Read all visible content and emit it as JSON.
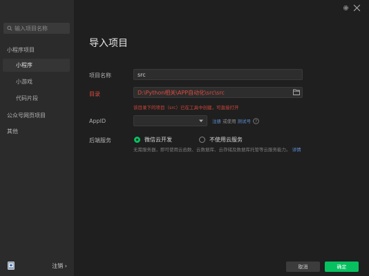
{
  "sidebar": {
    "search_placeholder": "输入项目名称",
    "group_miniprogram": "小程序项目",
    "items": [
      {
        "label": "小程序"
      },
      {
        "label": "小游戏"
      },
      {
        "label": "代码片段"
      }
    ],
    "group_official": "公众号网页项目",
    "group_other": "其他",
    "logout_label": "注销 ›"
  },
  "main": {
    "title": "导入项目",
    "project_name_label": "项目名称",
    "project_name_value": "src",
    "directory_label": "目录",
    "directory_value": "D:\\Python相关\\APP自动化\\src\\src",
    "directory_error": "该目录下的项目（src）已在工具中创建，可直接打开",
    "appid_label": "AppID",
    "appid_value": "",
    "appid_register": "注册",
    "appid_or": " 或使用 ",
    "appid_test": "测试号",
    "backend_label": "后端服务",
    "backend_options": [
      {
        "label": "微信云开发",
        "selected": true
      },
      {
        "label": "不使用云服务",
        "selected": false
      }
    ],
    "backend_desc": "无需服务器，即可使用云函数、云数据库、云存储及数据库托管等云服务能力。",
    "backend_desc_link": "详情"
  },
  "footer": {
    "cancel_label": "取消",
    "confirm_label": "确定"
  },
  "colors": {
    "accent": "#07c160",
    "error": "#e04b3e",
    "link": "#5f8fd4"
  }
}
